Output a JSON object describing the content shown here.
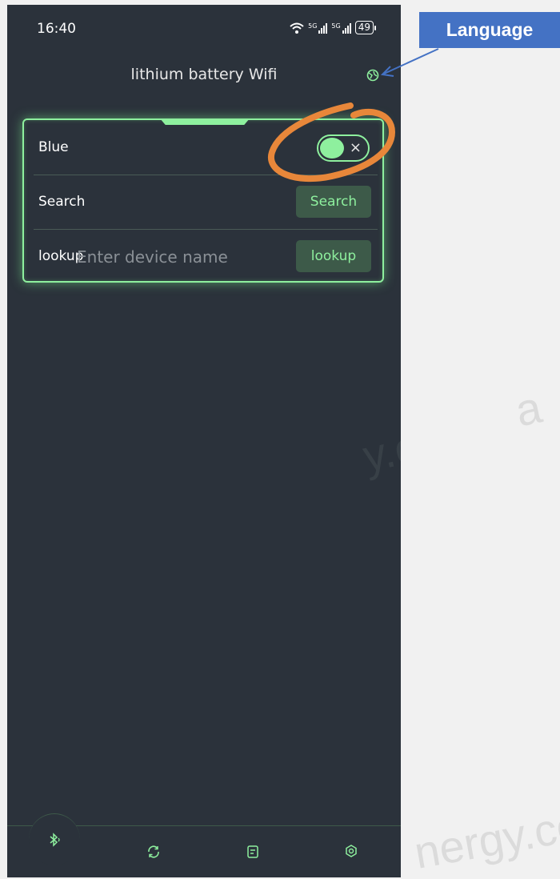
{
  "status_bar": {
    "time": "16:40",
    "battery": "49",
    "network_1": "5G",
    "network_2": "5G"
  },
  "header": {
    "title": "lithium battery Wifi"
  },
  "card": {
    "blue_label": "Blue",
    "search_label": "Search",
    "search_button": "Search",
    "lookup_label": "lookup",
    "lookup_placeholder": "Enter device name",
    "lookup_button": "lookup"
  },
  "toggle": {
    "close_glyph": "×"
  },
  "annotation": {
    "label": "Language"
  },
  "watermarks": [
    "y.com",
    "nergy.co",
    "a"
  ],
  "colors": {
    "accent": "#8ef09e",
    "background": "#2b323b",
    "annotation": "#4472c4",
    "circle": "#e8873a"
  },
  "bottom_nav": {
    "icons": [
      "bluetooth-icon",
      "refresh-icon",
      "document-icon",
      "settings-icon"
    ]
  }
}
